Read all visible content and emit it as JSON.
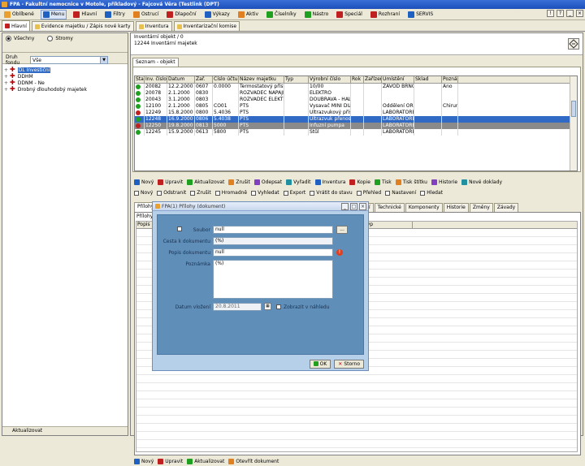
{
  "window": {
    "title": "FPA - Fakultní nemocnice v  Motole, příkladový - Fajcová Věra (Testlink (DPT)"
  },
  "menu": {
    "items": [
      {
        "label": "Oblíbené",
        "color": "#e8a030"
      },
      {
        "label": "Menu",
        "color": "#2060c0",
        "active": true
      },
      {
        "label": "Hlavní",
        "color": "#c02020"
      },
      {
        "label": "Filtry",
        "color": "#2060c0"
      },
      {
        "label": "Ostrucí",
        "color": "#e08020"
      },
      {
        "label": "Dlapoční",
        "color": "#c02020"
      },
      {
        "label": "Výkazy",
        "color": "#2060c0"
      },
      {
        "label": "Aktiv",
        "color": "#e08020"
      },
      {
        "label": "Číselníky",
        "color": "#20a020"
      },
      {
        "label": "Nástro",
        "color": "#20a020"
      },
      {
        "label": "Speciál",
        "color": "#c02020"
      },
      {
        "label": "Rozhraní",
        "color": "#c02020"
      },
      {
        "label": "SERVIS",
        "color": "#2060c0"
      }
    ],
    "right_icons": [
      "!",
      "?",
      "_",
      "×"
    ]
  },
  "window_tabs": [
    {
      "label": "Hlavní",
      "active": true
    },
    {
      "label": "Evidence majetku / Zápis nové karty",
      "active": false
    },
    {
      "label": "Inventura",
      "active": false
    },
    {
      "label": "Inventarizační komise",
      "active": false
    }
  ],
  "left": {
    "radio_all": "Všechny",
    "radio_tree": "Stromy",
    "filter_label": "Druh fondu",
    "filter_value": "Vše",
    "tree": [
      {
        "label": "DL Investiční",
        "selected": true
      },
      {
        "label": "DDHM",
        "selected": false
      },
      {
        "label": "DDNM - Ne",
        "selected": false
      },
      {
        "label": "Drobný dlouhodobý majetek",
        "selected": false
      }
    ],
    "bottom": "Aktualizovat"
  },
  "header": {
    "line1": "Inventární objekt / 0",
    "line2": "12244 Inventární majetek"
  },
  "inner_tab": "Seznam - objekt",
  "grid": {
    "columns": [
      "Stav",
      "Inv. číslo",
      "Datum",
      "Zař.",
      "Číslo účtu",
      "Název majetku",
      "Typ",
      "Výrobní číslo",
      "Rok",
      "Zařízení",
      "Umístění",
      "Sklad",
      "Poznámka"
    ],
    "rows": [
      {
        "status": "#20a020",
        "cells": [
          "",
          "20082",
          "12.2.2000",
          "0607",
          "0.0000",
          "Termostatový přístroj",
          "",
          "10/00",
          "",
          "",
          "ZÁVOD BRNO",
          "",
          "Ano"
        ]
      },
      {
        "status": "#20a020",
        "cells": [
          "",
          "20078",
          "2.1.2000",
          "0830",
          "",
          "ROZVADĚČ NAPÁJENÍ",
          "",
          "ELEKTRO",
          "",
          "",
          "",
          "",
          ""
        ]
      },
      {
        "status": "#20a020",
        "cells": [
          "",
          "20043",
          "3.1.2000",
          "0803",
          "",
          "ROZVADĚČ ELEKTR. TECH.",
          "",
          "DOUBRAVA - HAL",
          "",
          "",
          "",
          "",
          ""
        ]
      },
      {
        "status": "#20a020",
        "cells": [
          "",
          "12100",
          "2.1.2000",
          "0805",
          "CO01",
          "PTS",
          "",
          "Vysavač MINI DUST",
          "",
          "",
          "Oddělení ORL",
          "",
          "Chirurg"
        ]
      },
      {
        "status": "#c02020",
        "cells": [
          "",
          "12249",
          "15.8.2000",
          "0800",
          "5.4036",
          "PTS",
          "",
          "Ultrazvukový přístroj",
          "",
          "",
          "LABORATOŘE",
          "",
          ""
        ]
      },
      {
        "status": "#20a020",
        "cells": [
          "",
          "12248",
          "16.9.2000",
          "0806",
          "5.4038",
          "PTS",
          "",
          "Ultrazvuk přenosný",
          "",
          "",
          "LABORATOŘE",
          "",
          ""
        ],
        "selected": true
      },
      {
        "status": "#c02020",
        "cells": [
          "",
          "12250",
          "19.8.2000",
          "0813",
          "5000",
          "PTS",
          "",
          "Infuzní pumpa",
          "",
          "",
          "LABORATOŘE",
          "",
          ""
        ],
        "grey": true
      },
      {
        "status": "#20a020",
        "cells": [
          "",
          "12245",
          "15.9.2000",
          "0613",
          "5800",
          "PTS",
          "",
          "Stůl",
          "",
          "",
          "LABORATOŘE",
          "",
          ""
        ]
      }
    ]
  },
  "toolbar1": [
    "Nový",
    "Upravit",
    "Aktualizovat",
    "Zrušit",
    "Odepsat",
    "Vyřadit",
    "Inventura",
    "Kopie",
    "Tisk",
    "Tisk štítku",
    "Historie",
    "Nové doklady"
  ],
  "toolbar2": [
    "Nový",
    "Odstranit",
    "Zrušit",
    "Hromadně",
    "Vyhledat",
    "Export",
    "Vrátit do stavu",
    "Přehled",
    "Nastavení",
    "Hledat"
  ],
  "detail_tabs": [
    "Přílohy",
    "Úpravy",
    "Pohyby",
    "Odpisy",
    "Účetní",
    "Doklady",
    "Fotografie",
    "Dokumenty",
    "Ostatní",
    "Technické",
    "Komponenty",
    "Historie",
    "Změny",
    "Závady"
  ],
  "detail_section": "Přílohy",
  "subgrid_columns": [
    "Popis dokumentu",
    "Dokument",
    "Datum vložení",
    "Vložil",
    "Číslo dokladu",
    "Typ"
  ],
  "bottom_toolbar": [
    "Nový",
    "Upravit",
    "Aktualizovat",
    "Otevřít dokument"
  ],
  "dialog": {
    "title": "FPA(1) Přílohy (dokument)",
    "fields": {
      "soubor_label": "Soubor",
      "soubor_value": "null",
      "cesta_label": "Cesta k dokumentu",
      "cesta_value": "(%)",
      "popis_label": "Popis dokumentu",
      "popis_value": "null",
      "poznamka_label": "Poznámka",
      "poznamka_value": "(%)",
      "datum_label": "Datum vložení",
      "datum_value": "20.8.2011",
      "checkbox_label": "Zobrazit v náhledu"
    },
    "ok": "OK",
    "cancel": "Storno"
  }
}
